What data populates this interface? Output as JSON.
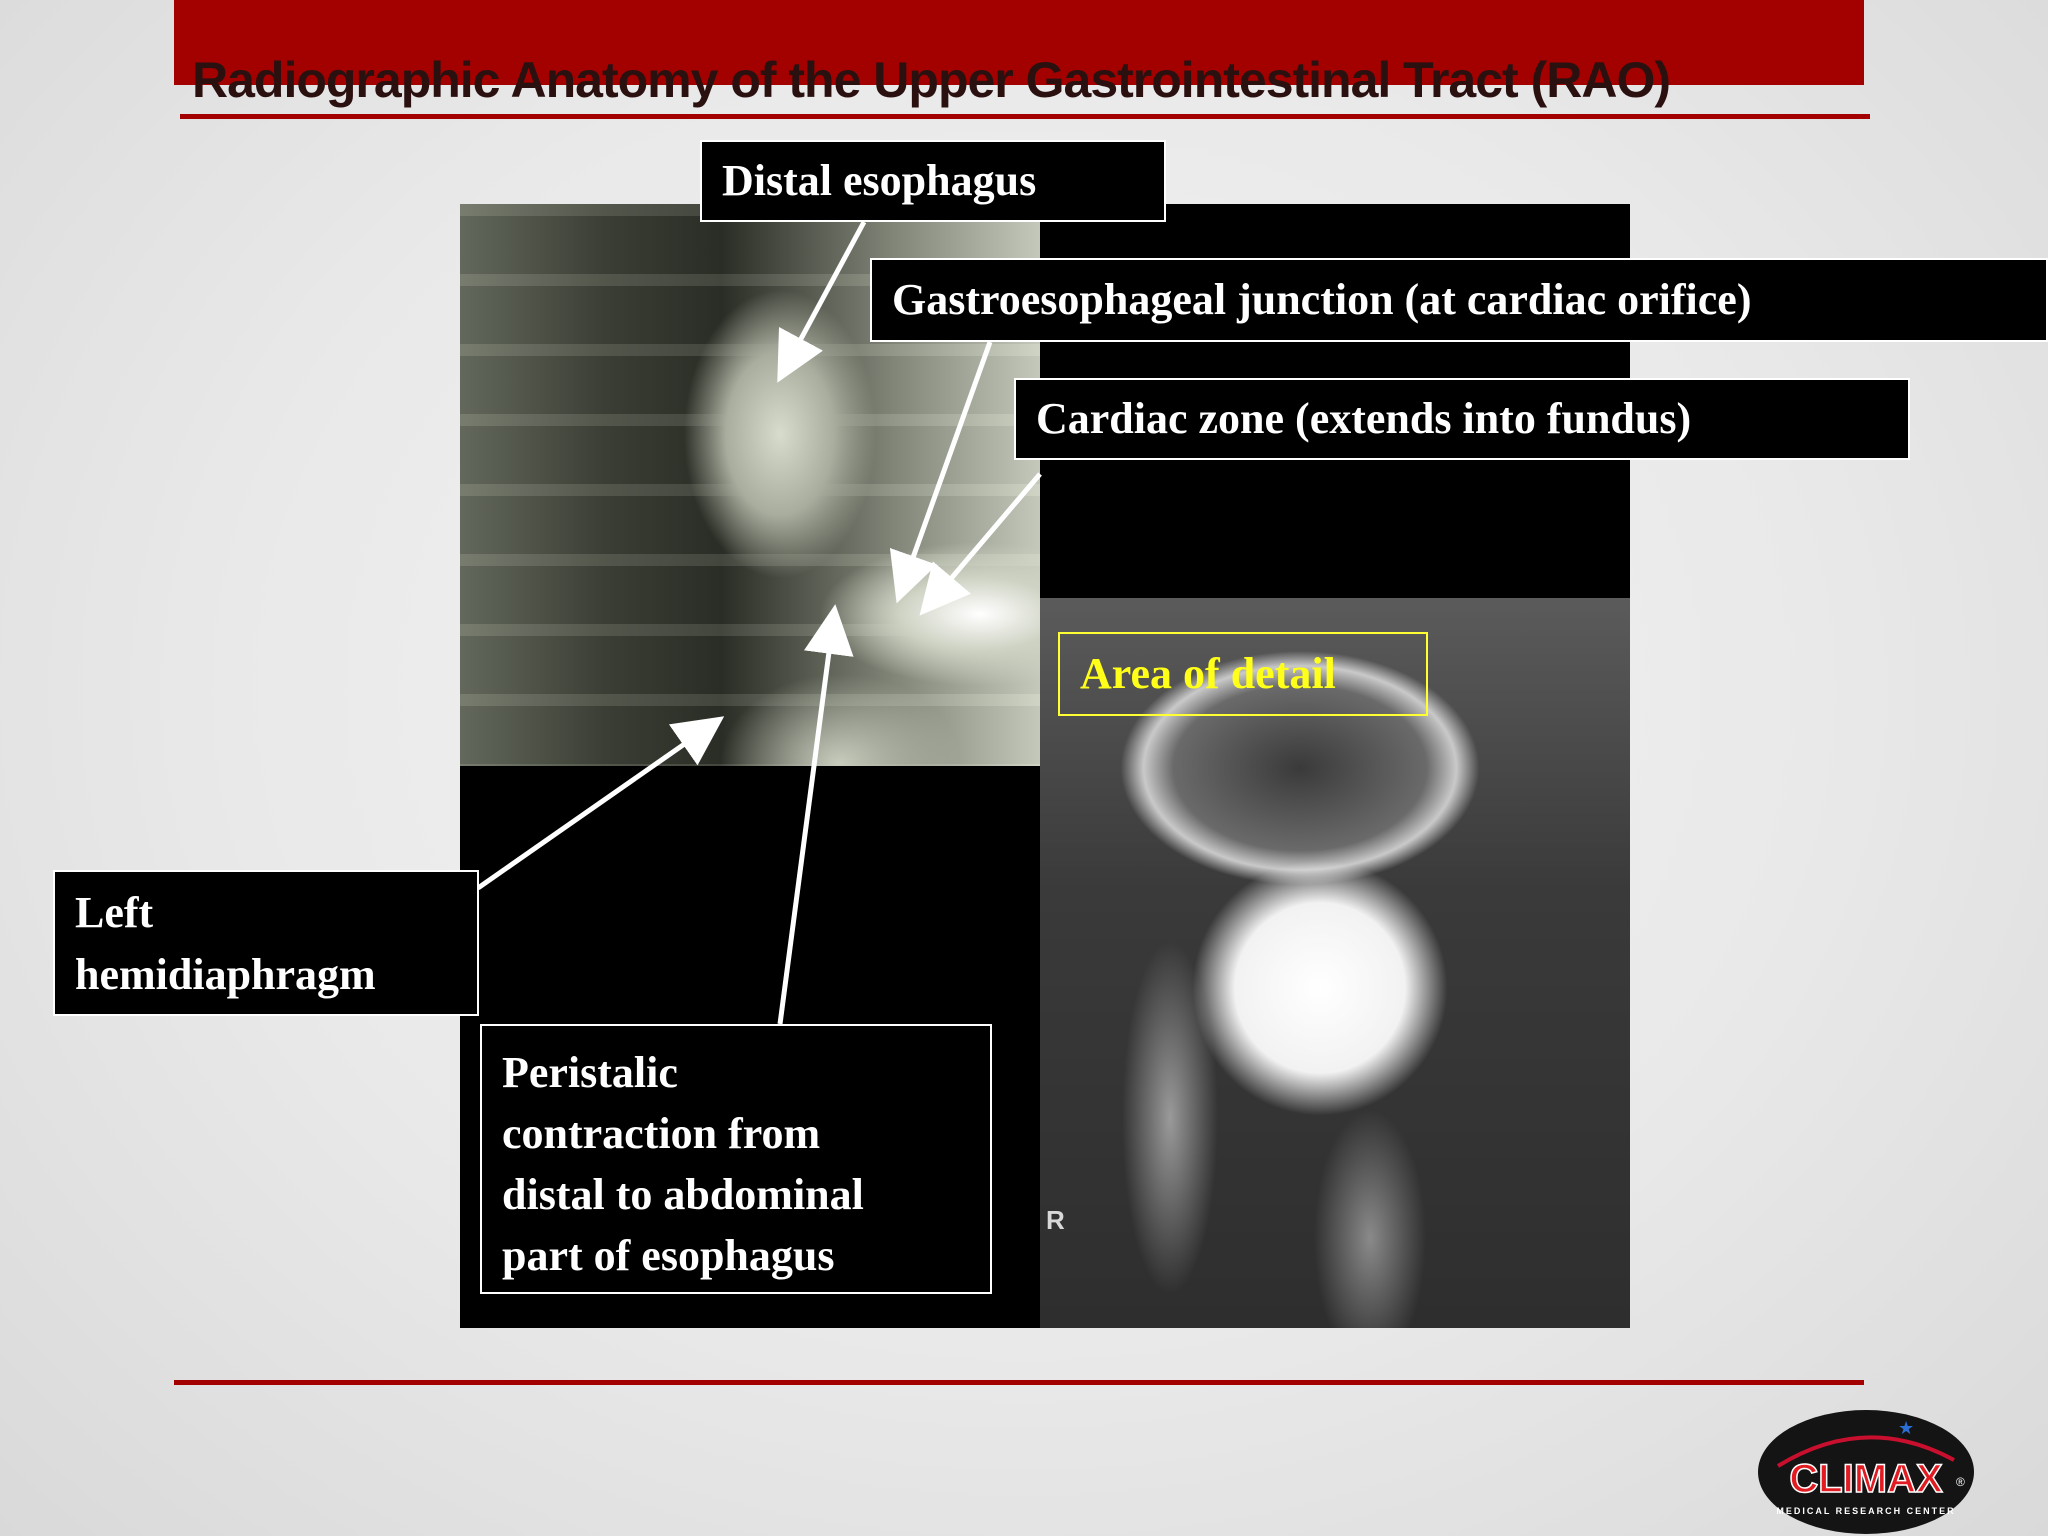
{
  "slide": {
    "title": "Radiographic Anatomy of the Upper Gastrointestinal Tract (RAO)"
  },
  "labels": {
    "distal_esophagus": "Distal esophagus",
    "gastroesophageal_junction": "Gastroesophageal junction (at cardiac orifice)",
    "cardiac_zone": "Cardiac zone (extends into fundus)",
    "area_of_detail": "Area of detail",
    "left_hemidiaphragm": [
      "Left",
      "hemidiaphragm"
    ],
    "peristalic_contraction": [
      "Peristalic",
      "contraction from",
      "distal to abdominal",
      "part of esophagus"
    ]
  },
  "radiograph": {
    "side_marker": "R"
  },
  "logo": {
    "name": "CLIMAX",
    "tagline": "MEDICAL RESEARCH CENTER",
    "registered": "®"
  },
  "colors": {
    "brand_red": "#a30000",
    "label_background": "#000000",
    "label_text": "#ffffff",
    "highlight_yellow": "#ffff1a"
  }
}
